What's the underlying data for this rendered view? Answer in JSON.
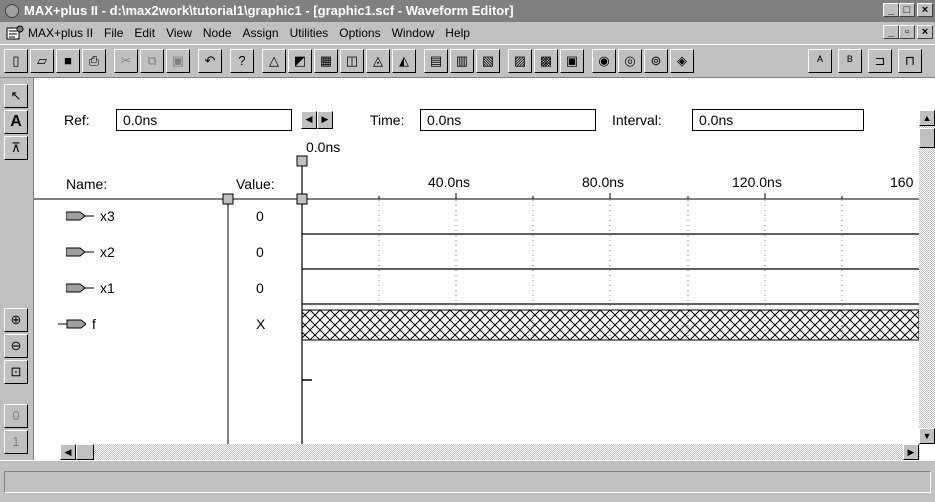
{
  "window": {
    "title": "MAX+plus II - d:\\max2work\\tutorial1\\graphic1 - [graphic1.scf - Waveform Editor]"
  },
  "menubar": {
    "items": [
      "MAX+plus II",
      "File",
      "Edit",
      "View",
      "Node",
      "Assign",
      "Utilities",
      "Options",
      "Window",
      "Help"
    ]
  },
  "refbar": {
    "ref_label": "Ref:",
    "ref_value": "0.0ns",
    "time_label": "Time:",
    "time_value": "0.0ns",
    "interval_label": "Interval:",
    "interval_value": "0.0ns"
  },
  "timeline": {
    "cursor_label": "0.0ns",
    "name_header": "Name:",
    "value_header": "Value:",
    "ticks": [
      "40.0ns",
      "80.0ns",
      "120.0ns",
      "160"
    ]
  },
  "signals": [
    {
      "name": "x3",
      "value": "0",
      "type": "input",
      "waveform": "low"
    },
    {
      "name": "x2",
      "value": "0",
      "type": "input",
      "waveform": "low"
    },
    {
      "name": "x1",
      "value": "0",
      "type": "input",
      "waveform": "low"
    },
    {
      "name": "f",
      "value": "X",
      "type": "output",
      "waveform": "undefined"
    }
  ],
  "colors": {
    "titlebar": "#808080",
    "face": "#c0c0c0",
    "canvas": "#ffffff"
  }
}
